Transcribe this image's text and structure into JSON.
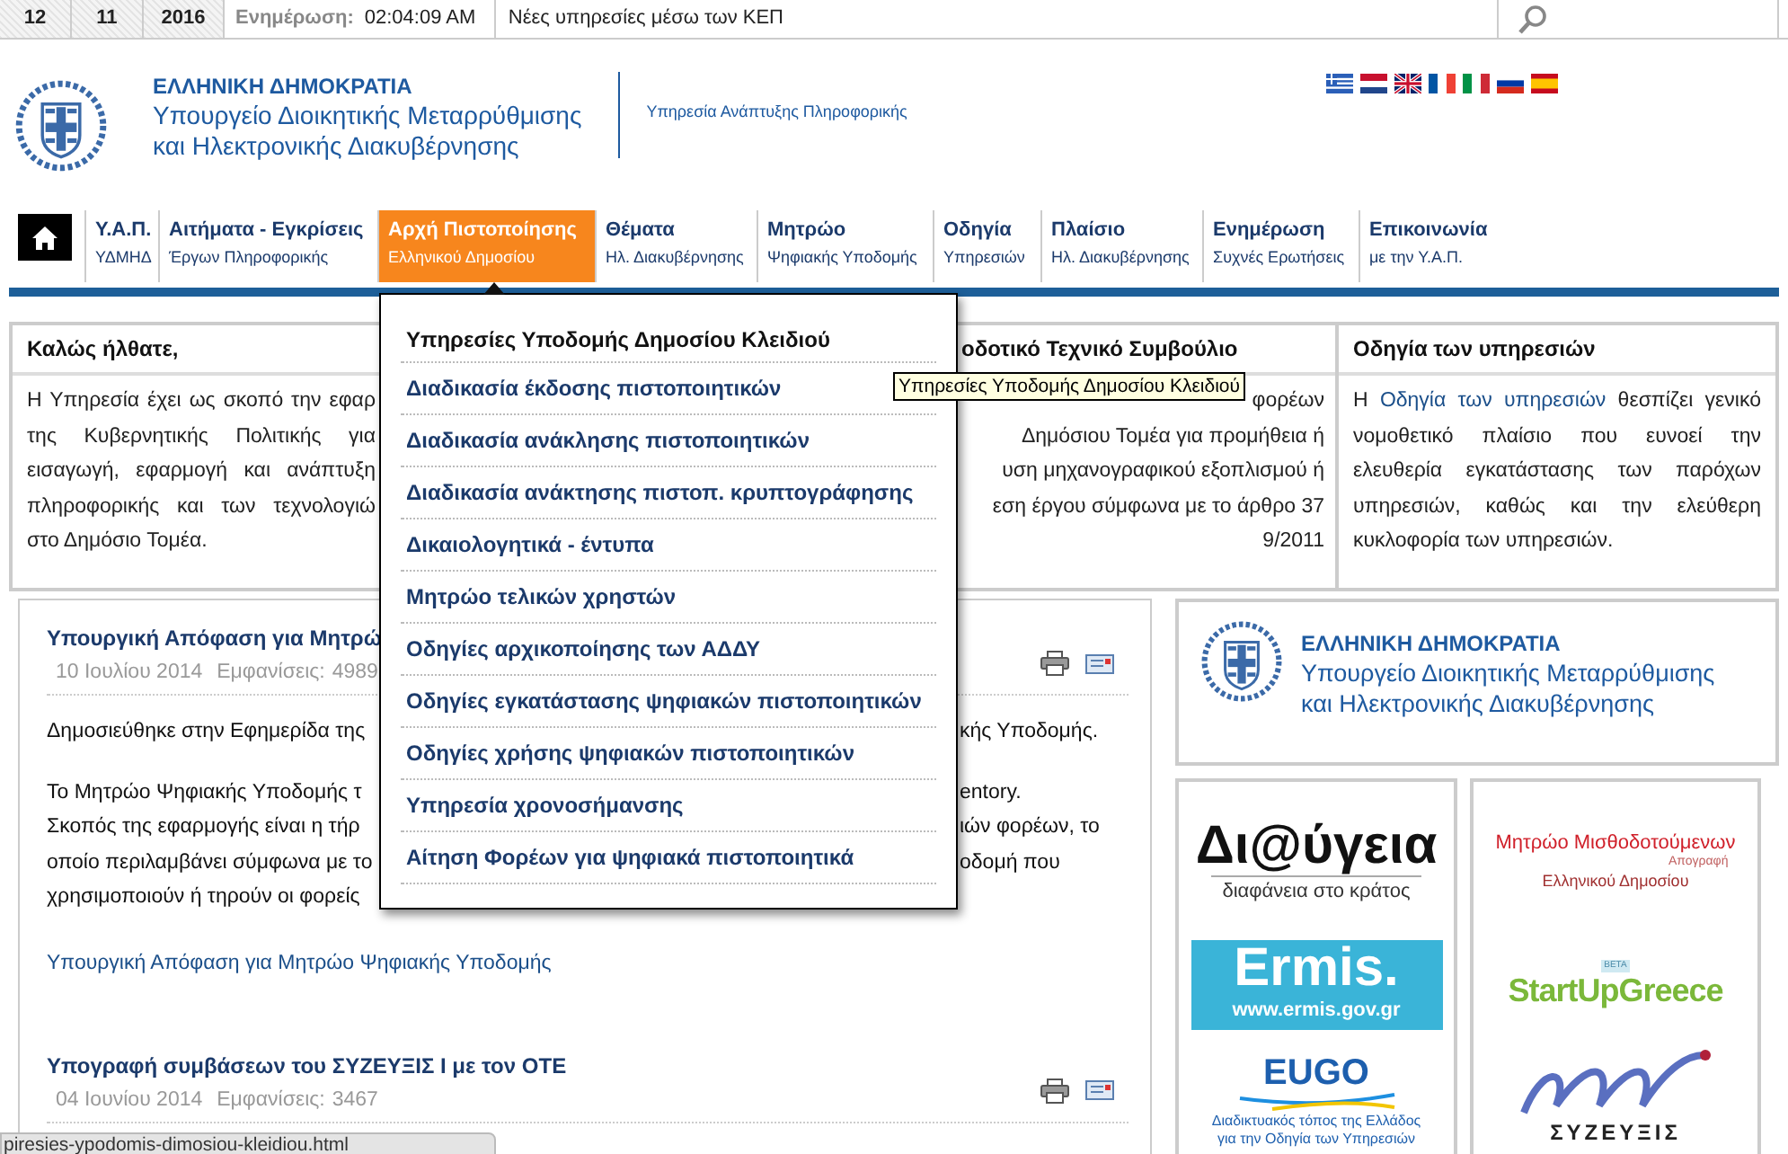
{
  "top_bar": {
    "date": [
      "12",
      "11",
      "2016"
    ],
    "update_label": "Ενημέρωση:",
    "update_time": "02:04:09 AM",
    "ticker": "Νέες υπηρεσίες μέσω των ΚΕΠ"
  },
  "header": {
    "country": "ΕΛΛΗΝΙΚΗ ΔΗΜΟΚΡΑΤΙΑ",
    "ministry": [
      "Υπουργείο Διοικητικής Μεταρρύθμισης",
      "και Ηλεκτρονικής Διακυβέρνησης"
    ],
    "service": "Υπηρεσία Ανάπτυξης Πληροφορικής",
    "languages": [
      {
        "kind": "greece"
      },
      {
        "kind": "netherlands"
      },
      {
        "kind": "uk"
      },
      {
        "kind": "france"
      },
      {
        "kind": "italy"
      },
      {
        "kind": "russia"
      },
      {
        "kind": "spain"
      }
    ]
  },
  "nav": {
    "items": [
      {
        "title": "Υ.Α.Π.",
        "subtitle": "ΥΔΜΗΔ",
        "selected": false
      },
      {
        "title": "Αιτήματα - Εγκρίσεις",
        "subtitle": "Έργων Πληροφορικής",
        "selected": false
      },
      {
        "title": "Αρχή Πιστοποίησης",
        "subtitle": "Ελληνικού Δημοσίου",
        "selected": true
      },
      {
        "title": "Θέματα",
        "subtitle": "Ηλ. Διακυβέρνησης",
        "selected": false
      },
      {
        "title": "Μητρώο",
        "subtitle": "Ψηφιακής Υποδομής",
        "selected": false
      },
      {
        "title": "Οδηγία",
        "subtitle": "Υπηρεσιών",
        "selected": false
      },
      {
        "title": "Πλαίσιο",
        "subtitle": "Ηλ. Διακυβέρνησης",
        "selected": false
      },
      {
        "title": "Ενημέρωση",
        "subtitle": "Συχνές Ερωτήσεις",
        "selected": false
      },
      {
        "title": "Επικοινωνία",
        "subtitle": "με την Υ.Α.Π.",
        "selected": false
      }
    ]
  },
  "dropdown": {
    "header": "Υπηρεσίες Υποδομής Δημοσίου Κλειδιού",
    "items": [
      "Διαδικασία έκδοσης πιστοποιητικών",
      "Διαδικασία ανάκλησης πιστοποιητικών",
      "Διαδικασία ανάκτησης πιστοπ. κρυπτογράφησης",
      "Δικαιολογητικά - έντυπα",
      "Μητρώο τελικών χρηστών",
      "Οδηγίες αρχικοποίησης των ΑΔΔΥ",
      "Οδηγίες εγκατάστασης ψηφιακών πιστοποιητικών",
      "Οδηγίες χρήσης ψηφιακών πιστοποιητικών",
      "Υπηρεσία χρονοσήμανσης",
      "Αίτηση Φορέων για ψηφιακά πιστοποιητικά"
    ]
  },
  "tooltip": "Υπηρεσίες Υποδομής Δημοσίου Κλειδιού",
  "info_boxes": [
    {
      "title": "Καλώς ήλθατε,",
      "lines": [
        "Η Υπηρεσία έχει ως σκοπό την εφαρ",
        "της Κυβερνητικής Πολιτικής για",
        "εισαγωγή, εφαρμογή και ανάπτυξη",
        "πληροφορικής και των τεχνολογιώ",
        "στο Δημόσιο Τομέα."
      ]
    },
    {
      "title": "οδοτικό Τεχνικό Συμβούλιο",
      "lines": [
        "φορέων",
        "Δημόσιου Τομέα για προμήθεια ή",
        "υση μηχανογραφικού εξοπλισμού ή",
        "εση έργου σύμφωνα με το άρθρο 37",
        "9/2011"
      ]
    },
    {
      "title": "Οδηγία των υπηρεσιών",
      "text_before": "Η",
      "link": "Οδηγία των υπηρεσιών",
      "text_after": "θεσπίζει γενικό νομοθετικό πλαίσιο που ευνοεί την ελευθερία εγκατάστασης των παρόχων υπηρεσιών, καθώς και την ελεύθερη κυκλοφορία των υπηρεσιών."
    }
  ],
  "articles": [
    {
      "title": "Υπουργική Απόφαση για Μητρώ",
      "date": "10 Ιουλίου 2014",
      "views_label": "Εμφανίσεις:",
      "views": "4989",
      "paragraphs": [
        [
          {
            "left": "Δημοσιεύθηκε στην Εφημερίδα της",
            "right": "κής Υποδομής."
          }
        ],
        [
          {
            "left": "Το Μητρώο Ψηφιακής Υποδομής τ",
            "right": "entory."
          },
          {
            "left": "Σκοπός της εφαρμογής είναι η τήρ",
            "right": "ιών φορέων, το"
          },
          {
            "left": "οποίο περιλαμβάνει σύμφωνα με το",
            "right": "οδομή που"
          },
          {
            "left": "χρησιμοποιούν ή τηρούν οι φορείς"
          }
        ]
      ],
      "link": "Υπουργική Απόφαση για Μητρώο Ψηφιακής Υποδομής"
    },
    {
      "title": "Υπογραφή συμβάσεων του ΣΥΖΕΥΞΙΣ Ι με τον ΟΤΕ",
      "date": "04 Ιουνίου 2014",
      "views_label": "Εμφανίσεις:",
      "views": "3467"
    }
  ],
  "sidebar": {
    "logo": {
      "country": "ΕΛΛΗΝΙΚΗ ΔΗΜΟΚΡΑΤΙΑ",
      "ministry": [
        "Υπουργείο Διοικητικής Μεταρρύθμισης",
        "και Ηλεκτρονικής Διακυβέρνησης"
      ]
    },
    "banner_columns": [
      [
        {
          "kind": "diavgeia",
          "name": "Δι@ύγεια",
          "tagline": "διαφάνεια στο κράτος"
        },
        {
          "kind": "ermis",
          "name": "Ermis.",
          "tagline": "www.ermis.gov.gr"
        },
        {
          "kind": "eugo",
          "name": "EUGO",
          "tagline": [
            "Διαδικτυακός τόπος της Ελλάδος",
            "για την Οδηγία των Υπηρεσιών"
          ]
        }
      ],
      [
        {
          "kind": "mitroo",
          "name": "Μητρώο Μισθοδοτούμενων",
          "extra": "Απογραφή",
          "tagline": "Ελληνικού Δημοσίου"
        },
        {
          "kind": "startup",
          "badge": "BETA",
          "name": "StartUpGreece"
        },
        {
          "kind": "syzefxis",
          "name": "ΣΥΖΕΥΞΙΣ"
        }
      ]
    ]
  },
  "status_bar": "piresies-ypodomis-dimosiou-kleidiou.html"
}
